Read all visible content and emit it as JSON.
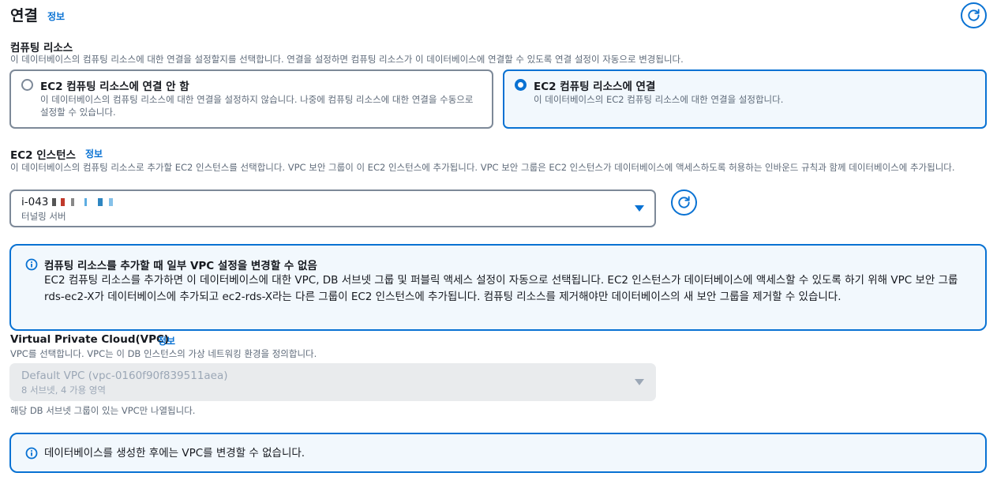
{
  "section": {
    "title": "연결",
    "info_link": "정보"
  },
  "compute": {
    "label": "컴퓨팅 리소스",
    "description": "이 데이터베이스의 컴퓨팅 리소스에 대한 연결을 설정할지를 선택합니다. 연결을 설정하면 컴퓨팅 리소스가 이 데이터베이스에 연결할 수 있도록 연결 설정이 자동으로 변경됩니다.",
    "options": [
      {
        "title": "EC2 컴퓨팅 리소스에 연결 안 함",
        "description": "이 데이터베이스의 컴퓨팅 리소스에 대한 연결을 설정하지 않습니다. 나중에 컴퓨팅 리소스에 대한 연결을 수동으로 설정할 수 있습니다.",
        "selected": false
      },
      {
        "title": "EC2 컴퓨팅 리소스에 연결",
        "description": "이 데이터베이스의 EC2 컴퓨팅 리소스에 대한 연결을 설정합니다.",
        "selected": true
      }
    ]
  },
  "ec2": {
    "label": "EC2 인스턴스",
    "info_link": "정보",
    "description": "이 데이터베이스의 컴퓨팅 리소스로 추가할 EC2 인스턴스를 선택합니다. VPC 보안 그룹이 이 EC2 인스턴스에 추가됩니다. VPC 보안 그룹은 EC2 인스턴스가 데이터베이스에 액세스하도록 허용하는 인바운드 규칙과 함께 데이터베이스에 추가됩니다.",
    "selected_value": "i-043",
    "selected_sub": "터널링 서버"
  },
  "alert1": {
    "title": "컴퓨팅 리소스를 추가할 때 일부 VPC 설정을 변경할 수 없음",
    "body": "EC2 컴퓨팅 리소스를 추가하면 이 데이터베이스에 대한 VPC, DB 서브넷 그룹 및 퍼블릭 액세스 설정이 자동으로 선택됩니다. EC2 인스턴스가 데이터베이스에 액세스할 수 있도록 하기 위해 VPC 보안 그룹 rds-ec2-X가 데이터베이스에 추가되고 ec2-rds-X라는 다른 그룹이 EC2 인스턴스에 추가됩니다. 컴퓨팅 리소스를 제거해야만 데이터베이스의 새 보안 그룹을 제거할 수 있습니다."
  },
  "vpc": {
    "label": "Virtual Private Cloud(VPC)",
    "info_link": "정보",
    "description": "VPC를 선택합니다. VPC는 이 DB 인스턴스의 가상 네트워킹 환경을 정의합니다.",
    "selected_value": "Default VPC (vpc-0160f90f839511aea)",
    "selected_sub": "8 서브넷, 4 가용 영역",
    "hint": "해당 DB 서브넷 그룹이 있는 VPC만 나열됩니다."
  },
  "alert2": {
    "body": "데이터베이스를 생성한 후에는 VPC를 변경할 수 없습니다."
  },
  "icons": {
    "refresh": "refresh-icon",
    "info": "info-circle-icon",
    "caret": "caret-down-icon"
  },
  "colors": {
    "accent": "#0972d3",
    "selected_bg": "#f2f8fd",
    "border": "#7d8998",
    "disabled_bg": "#e9ebed",
    "text_secondary": "#5f6b7a"
  }
}
